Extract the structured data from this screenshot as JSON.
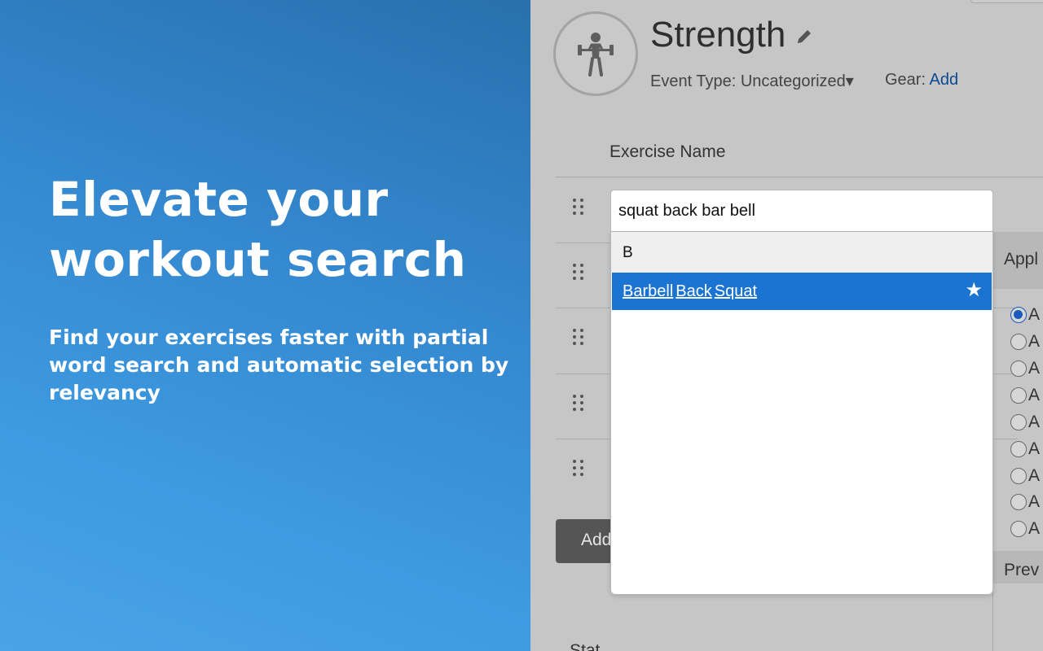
{
  "promo": {
    "headline": "Elevate your workout search",
    "subtext": "Find your exercises faster with partial word search and automatic selection by relevancy"
  },
  "activity": {
    "icon": "weightlifter-icon",
    "title": "Strength",
    "event_type_label": "Event Type:",
    "event_type_value": "Uncategorized",
    "event_type_arrow": "▾",
    "gear_label": "Gear:",
    "gear_link": "Add"
  },
  "table": {
    "column_header": "Exercise Name",
    "add_button": "Add",
    "status_label": "Stat"
  },
  "side_panel": {
    "header": "Appl",
    "options": [
      "A",
      "A",
      "A",
      "A",
      "A",
      "A",
      "A",
      "A",
      "A"
    ],
    "selected_index": 0,
    "preview_label": "Prev"
  },
  "search": {
    "value": "squat back bar bell",
    "group_header": "B",
    "results": [
      {
        "words": [
          "Barbell",
          "Back",
          "Squat"
        ],
        "favorite": true,
        "star": "★"
      }
    ]
  },
  "colors": {
    "highlight": "#1b74d2",
    "link": "#0b4a92",
    "promo_gradient_start": "#2870ad",
    "promo_gradient_end": "#4aa3e6"
  }
}
